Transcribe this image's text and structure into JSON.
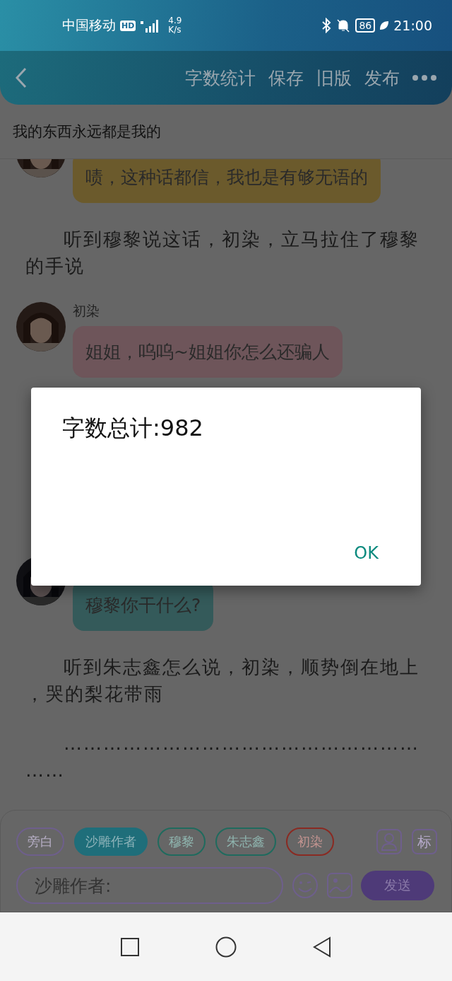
{
  "status_bar": {
    "carrier": "中国移动",
    "network_badge": "HD",
    "speed_value": "4.9",
    "speed_unit": "K/s",
    "battery": "86",
    "time": "21:00"
  },
  "header": {
    "actions": [
      "字数统计",
      "保存",
      "旧版",
      "发布"
    ]
  },
  "story_title": "我的东西永远都是我的",
  "items": [
    {
      "kind": "bubble",
      "text": "啧，这种话都信，我也是有够无语的",
      "color": "#6b5a2c"
    },
    {
      "kind": "narration",
      "text": "听到穆黎说这话，初染，立马拉住了穆黎的手说"
    },
    {
      "kind": "bubble",
      "name": "初染",
      "text": "姐姐，呜呜~姐姐你怎么还骗人",
      "color": "#6e555a"
    },
    {
      "kind": "bubble",
      "text": "穆黎你干什么?",
      "color": "#345a5a"
    },
    {
      "kind": "narration",
      "text": "听到朱志鑫怎么说，初染，顺势倒在地上，哭的梨花带雨"
    },
    {
      "kind": "narration",
      "text": "……………………………………………………"
    }
  ],
  "dialog": {
    "message": "字数总计:982",
    "button": "OK"
  },
  "roles": [
    {
      "label": "旁白",
      "color": "#6e5f8c",
      "selected": false
    },
    {
      "label": "沙雕作者",
      "color": "#1f6e7a",
      "selected": true
    },
    {
      "label": "穆黎",
      "color": "#1f6b5e",
      "selected": false
    },
    {
      "label": "朱志鑫",
      "color": "#1f6b5e",
      "selected": false
    },
    {
      "label": "初染",
      "color": "#8a2a22",
      "selected": false
    }
  ],
  "tag_button": "标",
  "input": {
    "placeholder": "沙雕作者:"
  },
  "send_button": "发送"
}
